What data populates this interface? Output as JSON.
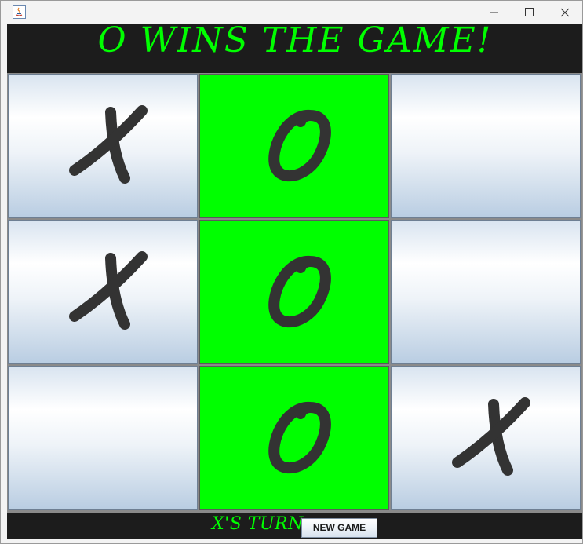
{
  "window": {
    "title": "",
    "controls": {
      "minimize_icon": "minimize-icon",
      "maximize_icon": "maximize-icon",
      "close_icon": "close-icon"
    }
  },
  "game": {
    "banner": "O WINS THE GAME!",
    "turn_text": "X'S TURN",
    "new_game_label": "NEW GAME",
    "accent_color": "#00ff00",
    "board": [
      {
        "mark": "X",
        "winning": false
      },
      {
        "mark": "O",
        "winning": true
      },
      {
        "mark": "",
        "winning": false
      },
      {
        "mark": "X",
        "winning": false
      },
      {
        "mark": "O",
        "winning": true
      },
      {
        "mark": "",
        "winning": false
      },
      {
        "mark": "",
        "winning": false
      },
      {
        "mark": "O",
        "winning": true
      },
      {
        "mark": "X",
        "winning": false
      }
    ]
  }
}
